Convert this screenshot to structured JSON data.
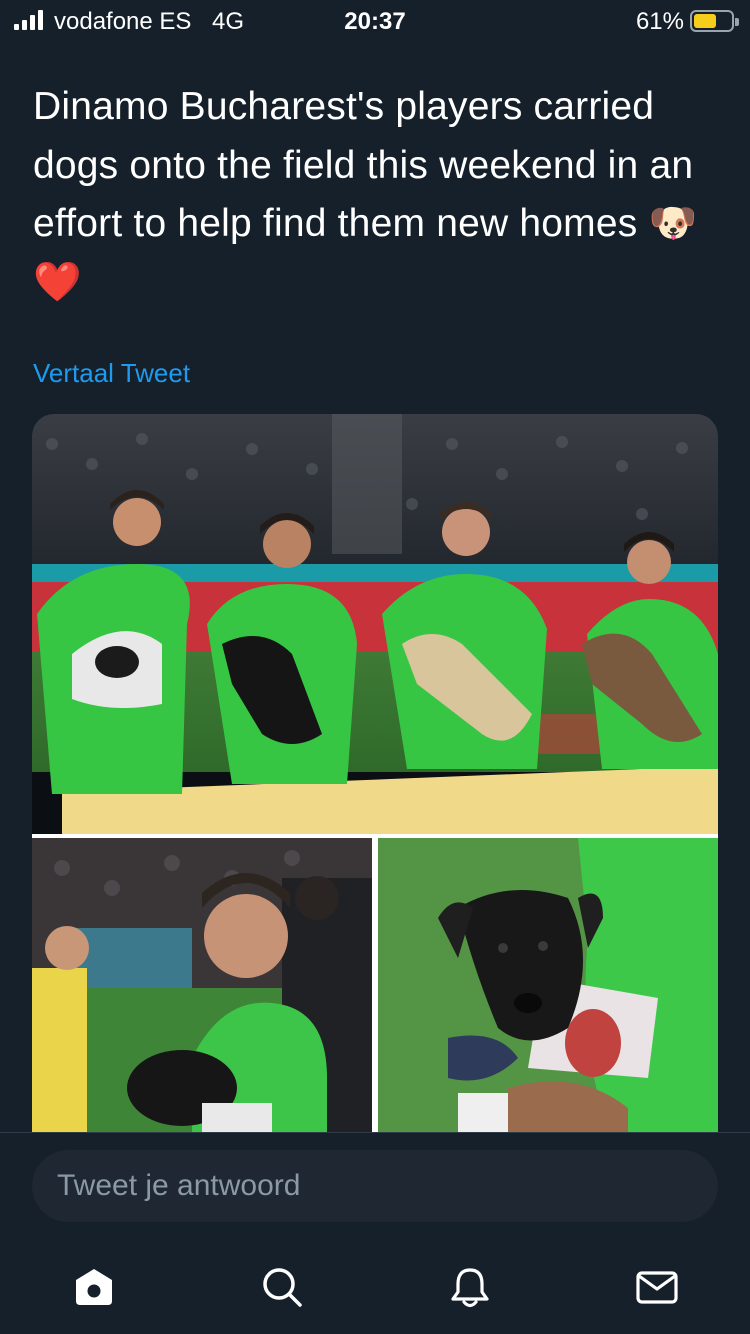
{
  "status_bar": {
    "carrier": "vodafone ES",
    "network": "4G",
    "time": "20:37",
    "battery_percent": "61%",
    "battery_level": 0.61,
    "signal_icon": "signal-bars-icon",
    "battery_icon": "battery-icon"
  },
  "tweet": {
    "text": "Dinamo Bucharest's players carried dogs onto the field this weekend in an effort to help find them new homes 🐶 ❤️",
    "translate_label": "Vertaal Tweet"
  },
  "media": {
    "images": [
      "players-holding-dogs-photo",
      "player-with-puppy-photo",
      "black-puppy-closeup-photo"
    ]
  },
  "reply": {
    "placeholder": "Tweet je antwoord"
  },
  "tab_bar": {
    "items": [
      "home-icon",
      "search-icon",
      "notifications-icon",
      "messages-icon"
    ]
  },
  "colors": {
    "background": "#15202b",
    "link": "#1d9bf0",
    "reply_box": "#1e2732",
    "placeholder": "#8b98a5",
    "battery": "#f7cd1b"
  }
}
